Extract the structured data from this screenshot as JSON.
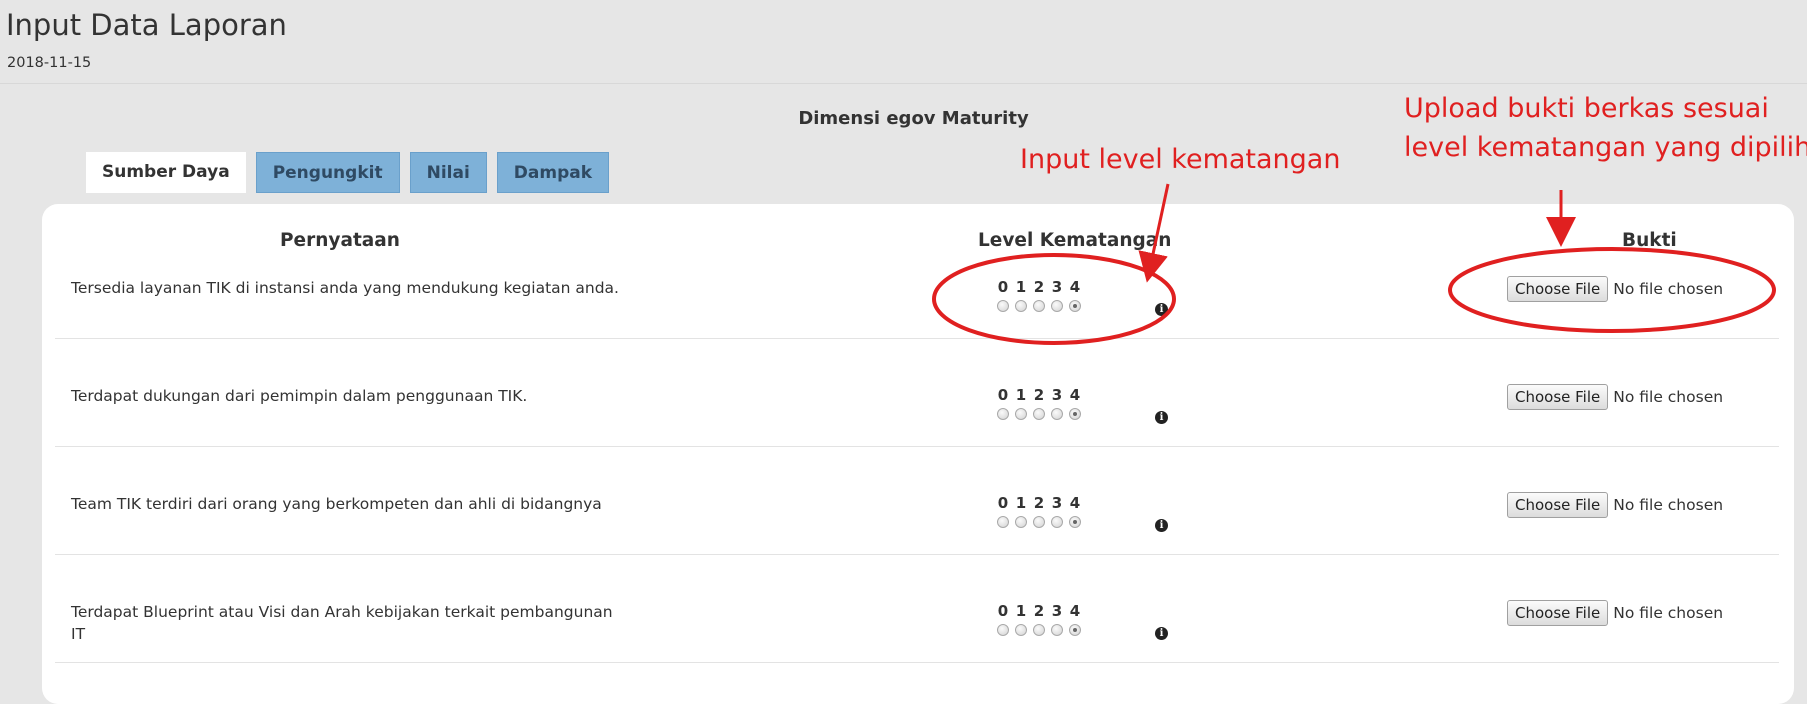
{
  "page": {
    "title": "Input Data Laporan",
    "date": "2018-11-15"
  },
  "dimension_title": "Dimensi egov Maturity",
  "tabs": [
    {
      "label": "Sumber Daya",
      "active": true
    },
    {
      "label": "Pengungkit",
      "active": false
    },
    {
      "label": "Nilai",
      "active": false
    },
    {
      "label": "Dampak",
      "active": false
    }
  ],
  "table": {
    "headers": {
      "statement": "Pernyataan",
      "level": "Level Kematangan",
      "proof": "Bukti"
    },
    "level_options": [
      "0",
      "1",
      "2",
      "3",
      "4"
    ],
    "rows": [
      {
        "statement": "Tersedia layanan TIK di instansi anda yang mendukung kegiatan anda.",
        "selected_level": "4",
        "file_button": "Choose File",
        "file_status": "No file chosen"
      },
      {
        "statement": "Terdapat dukungan dari pemimpin dalam penggunaan TIK.",
        "selected_level": "4",
        "file_button": "Choose File",
        "file_status": "No file chosen"
      },
      {
        "statement": "Team TIK terdiri dari orang yang berkompeten dan ahli di bidangnya",
        "selected_level": "4",
        "file_button": "Choose File",
        "file_status": "No file chosen"
      },
      {
        "statement": "Terdapat Blueprint atau Visi dan Arah kebijakan terkait pembangunan IT",
        "selected_level": "4",
        "file_button": "Choose File",
        "file_status": "No file chosen"
      }
    ]
  },
  "annotations": {
    "level": "Input level kematangan",
    "upload_line1": "Upload bukti berkas sesuai",
    "upload_line2": "level kematangan yang dipilih",
    "color": "#e02020"
  },
  "icons": {
    "info": "info-circle-icon"
  }
}
